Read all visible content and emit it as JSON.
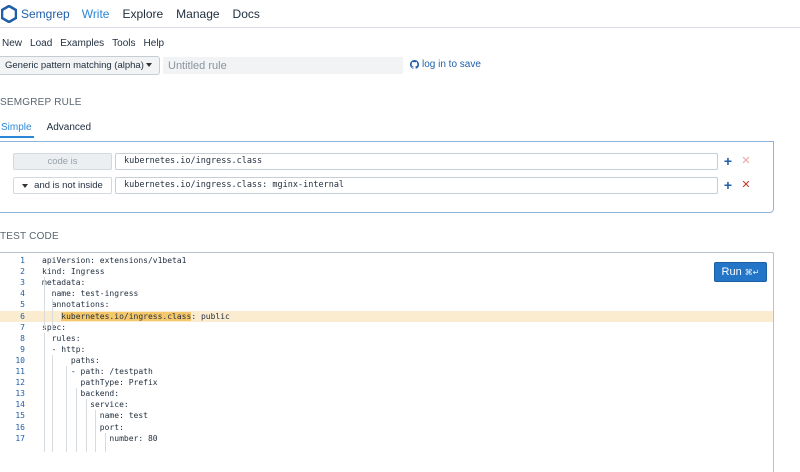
{
  "nav": {
    "brand": "Semgrep",
    "links": [
      "Write",
      "Explore",
      "Manage",
      "Docs"
    ],
    "active_link": "Write"
  },
  "menu": {
    "items": [
      "New",
      "Load",
      "Examples",
      "Tools",
      "Help"
    ]
  },
  "toolbar": {
    "language": "Generic pattern matching (alpha)",
    "title_placeholder": "Untitled rule",
    "login_label": "log in to save"
  },
  "rule_section": {
    "heading": "SEMGREP RULE",
    "tabs": [
      {
        "label": "Simple",
        "active": true
      },
      {
        "label": "Advanced",
        "active": false
      }
    ],
    "rows": [
      {
        "operator": "code is",
        "pattern": "kubernetes.io/ingress.class"
      },
      {
        "operator": "and is not inside",
        "pattern": "kubernetes.io/ingress.class: mginx-internal"
      }
    ]
  },
  "test_section": {
    "heading": "TEST CODE",
    "run_label": "Run",
    "run_shortcut": "⌘↵",
    "highlighted_line": 6,
    "lines": [
      {
        "num": "1",
        "pre": "apiVersion: extensions/v1beta1"
      },
      {
        "num": "2",
        "pre": "kind: Ingress"
      },
      {
        "num": "3",
        "pre": "metadata:"
      },
      {
        "num": "4",
        "pre": "  name: test-ingress"
      },
      {
        "num": "5",
        "pre": "  annotations:"
      },
      {
        "num": "6",
        "pre": "    ",
        "match": "kubernetes.io/ingress.class",
        "post": ": public"
      },
      {
        "num": "7",
        "pre": "spec:"
      },
      {
        "num": "8",
        "pre": "  rules:"
      },
      {
        "num": "9",
        "pre": "  - http:"
      },
      {
        "num": "10",
        "pre": "      paths:"
      },
      {
        "num": "11",
        "pre": "      - path: /testpath"
      },
      {
        "num": "12",
        "pre": "        pathType: Prefix"
      },
      {
        "num": "13",
        "pre": "        backend:"
      },
      {
        "num": "14",
        "pre": "          service:"
      },
      {
        "num": "15",
        "pre": "            name: test"
      },
      {
        "num": "16",
        "pre": "            port:"
      },
      {
        "num": "17",
        "pre": "              number: 80"
      }
    ]
  },
  "colors": {
    "accent": "#2a86d8",
    "run_button": "#2375c8",
    "match_highlight": "#f6c86c",
    "line_highlight": "#fbecd0"
  }
}
